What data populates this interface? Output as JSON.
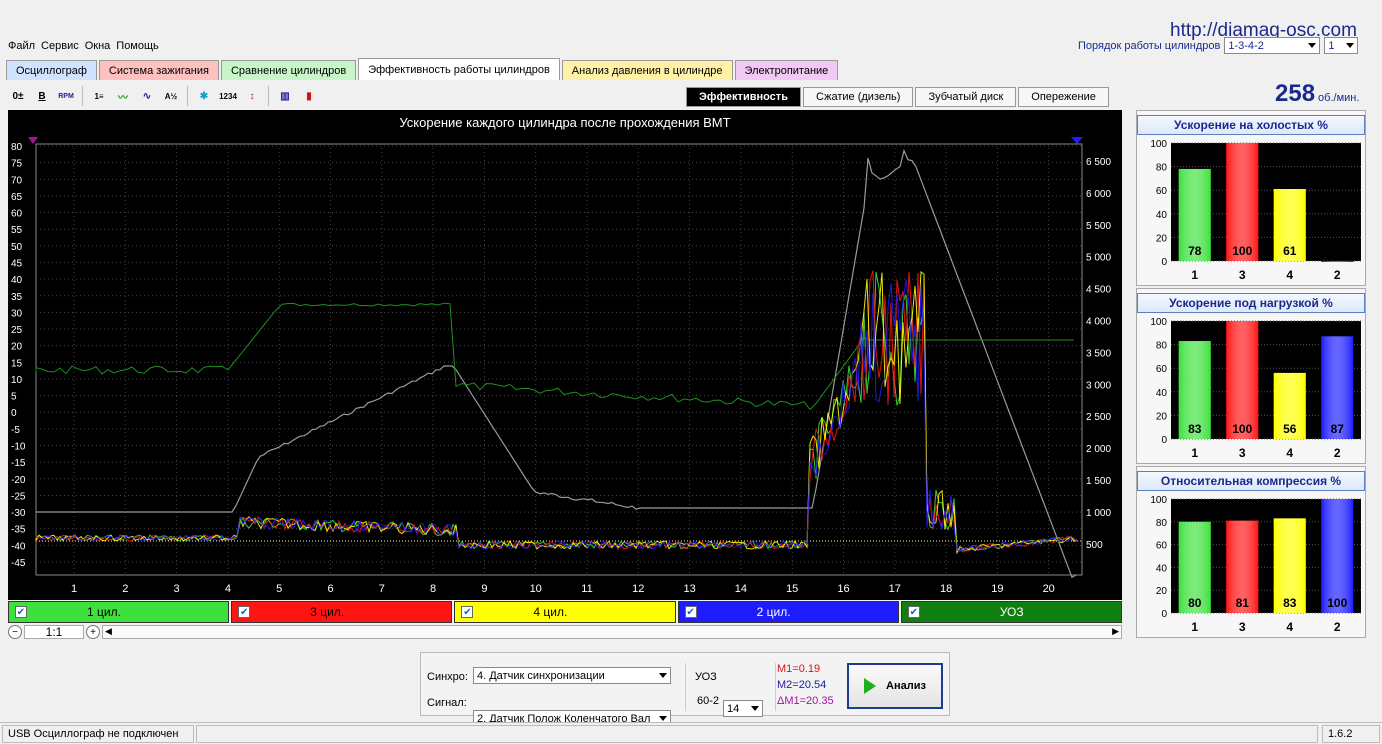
{
  "url": "http://diamag-osc.com",
  "menu": [
    "Файл",
    "Сервис",
    "Окна",
    "Помощь"
  ],
  "order": {
    "label": "Порядок работы цилиндров",
    "value": "1-3-4-2",
    "spin_value": "1"
  },
  "tabs": [
    {
      "label": "Осциллограф",
      "color": "#cfe3ff"
    },
    {
      "label": "Система зажигания",
      "color": "#ffc0c0"
    },
    {
      "label": "Сравнение цилиндров",
      "color": "#c8f5c8"
    },
    {
      "label": "Эффективность работы цилиндров",
      "color": "#ffffff"
    },
    {
      "label": "Анализ давления в цилиндре",
      "color": "#fff2a6"
    },
    {
      "label": "Электропитание",
      "color": "#f2c8f5"
    }
  ],
  "subtabs": [
    "Эффективность",
    "Сжатие (дизель)",
    "Зубчатый диск",
    "Опережение"
  ],
  "rpm": {
    "value": "258",
    "unit": "об./мин."
  },
  "chart": {
    "title": "Ускорение каждого цилиндра после прохождения ВМТ",
    "left_ticks": [
      "80",
      "75",
      "70",
      "65",
      "60",
      "55",
      "50",
      "45",
      "40",
      "35",
      "30",
      "25",
      "20",
      "15",
      "10",
      "5",
      "0",
      "-5",
      "-10",
      "-15",
      "-20",
      "-25",
      "-30",
      "-35",
      "-40",
      "-45"
    ],
    "right_ticks": [
      "6 500",
      "6 000",
      "5 500",
      "5 000",
      "4 500",
      "4 000",
      "3 500",
      "3 000",
      "2 500",
      "2 000",
      "1 500",
      "1 000",
      "500"
    ],
    "x_ticks": [
      "1",
      "2",
      "3",
      "4",
      "5",
      "6",
      "7",
      "8",
      "9",
      "10",
      "11",
      "12",
      "13",
      "14",
      "15",
      "16",
      "17",
      "18",
      "19",
      "20"
    ]
  },
  "legend": [
    {
      "label": "1 цил.",
      "color": "#3de03d"
    },
    {
      "label": "3 цил.",
      "color": "#ff1414"
    },
    {
      "label": "4 цил.",
      "color": "#ffff00"
    },
    {
      "label": "2 цил.",
      "color": "#1c1cff"
    },
    {
      "label": "УОЗ",
      "color": "#0f7f0f"
    }
  ],
  "zoom": {
    "label": "1:1"
  },
  "panels": [
    {
      "title": "Ускорение на холостых %",
      "yticks": [
        "100",
        "80",
        "60",
        "40",
        "20",
        "0"
      ],
      "bars": [
        {
          "cyl": "1",
          "value": 78,
          "label": "78",
          "color": "#3de03d"
        },
        {
          "cyl": "3",
          "value": 100,
          "label": "100",
          "color": "#ff1414"
        },
        {
          "cyl": "4",
          "value": 61,
          "label": "61",
          "color": "#ffff00"
        },
        {
          "cyl": "2",
          "value": 0,
          "label": "",
          "color": "#1c1cff"
        }
      ]
    },
    {
      "title": "Ускорение под нагрузкой %",
      "yticks": [
        "100",
        "80",
        "60",
        "40",
        "20",
        "0"
      ],
      "bars": [
        {
          "cyl": "1",
          "value": 83,
          "label": "83",
          "color": "#3de03d"
        },
        {
          "cyl": "3",
          "value": 100,
          "label": "100",
          "color": "#ff1414"
        },
        {
          "cyl": "4",
          "value": 56,
          "label": "56",
          "color": "#ffff00"
        },
        {
          "cyl": "2",
          "value": 87,
          "label": "87",
          "color": "#1c1cff"
        }
      ]
    },
    {
      "title": "Относительная компрессия %",
      "yticks": [
        "100",
        "80",
        "60",
        "40",
        "20",
        "0"
      ],
      "bars": [
        {
          "cyl": "1",
          "value": 80,
          "label": "80",
          "color": "#3de03d"
        },
        {
          "cyl": "3",
          "value": 81,
          "label": "81",
          "color": "#ff1414"
        },
        {
          "cyl": "4",
          "value": 83,
          "label": "83",
          "color": "#ffff00"
        },
        {
          "cyl": "2",
          "value": 100,
          "label": "100",
          "color": "#1c1cff"
        }
      ]
    }
  ],
  "controls": {
    "sync_label": "Синхро:",
    "sync_value": "4.  Датчик синхронизации",
    "signal_label": "Сигнал:",
    "signal_value": "2.  Датчик Полож Коленчатого Вал",
    "uoz_label": "УОЗ",
    "uoz_value": "14",
    "teeth": "60-2",
    "m1": "M1=0.19",
    "m2": "M2=20.54",
    "dm1": "ΔM1=20.35",
    "analyze": "Анализ"
  },
  "status": {
    "left": "USB Осциллограф не подключен",
    "version": "1.6.2"
  }
}
